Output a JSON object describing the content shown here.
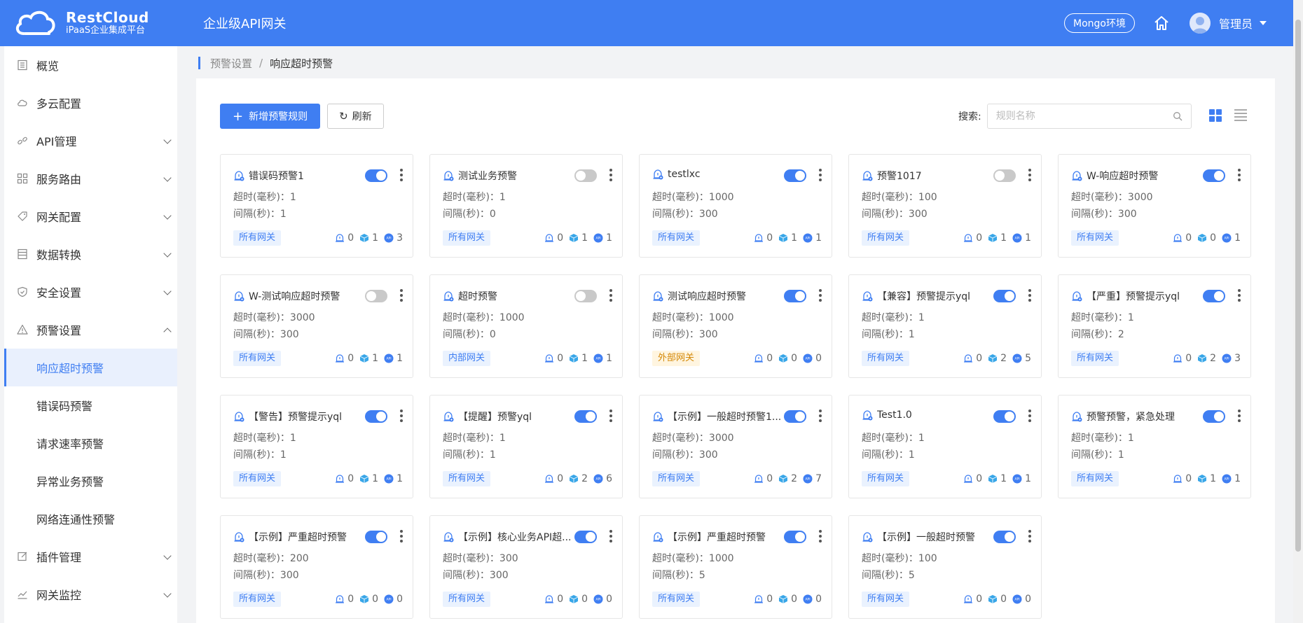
{
  "header": {
    "brand_name": "RestCloud",
    "brand_sub": "iPaaS企业集成平台",
    "title": "企业级API网关",
    "env": "Mongo环境",
    "user": "管理员"
  },
  "sidebar": {
    "items": [
      {
        "label": "概览",
        "icon": "list-icon"
      },
      {
        "label": "多云配置",
        "icon": "cloud-icon"
      },
      {
        "label": "API管理",
        "icon": "link-icon"
      },
      {
        "label": "服务路由",
        "icon": "grid-icon"
      },
      {
        "label": "网关配置",
        "icon": "tag-icon"
      },
      {
        "label": "数据转换",
        "icon": "table-icon"
      },
      {
        "label": "安全设置",
        "icon": "shield-icon"
      },
      {
        "label": "预警设置",
        "icon": "warning-icon"
      },
      {
        "label": "插件管理",
        "icon": "edit-icon"
      },
      {
        "label": "网关监控",
        "icon": "chart-icon"
      }
    ],
    "sub_items": [
      "响应超时预警",
      "错误码预警",
      "请求速率预警",
      "异常业务预警",
      "网络连通性预警"
    ]
  },
  "breadcrumb": {
    "parent": "预警设置",
    "separator": "/",
    "current": "响应超时预警"
  },
  "toolbar": {
    "add_label": "新增预警规则",
    "refresh_label": "刷新",
    "search_label": "搜索:",
    "search_placeholder": "规则名称"
  },
  "cards": [
    {
      "title": "错误码预警1",
      "enabled": true,
      "timeout": "超时(毫秒)：1",
      "interval": "间隔(秒)：1",
      "scope": "所有网关",
      "stats": [
        "0",
        "1",
        "3"
      ]
    },
    {
      "title": "测试业务预警",
      "enabled": false,
      "timeout": "超时(毫秒)：1",
      "interval": "间隔(秒)：0",
      "scope": "所有网关",
      "stats": [
        "0",
        "1",
        "1"
      ]
    },
    {
      "title": "testlxc",
      "enabled": true,
      "timeout": "超时(毫秒)：1000",
      "interval": "间隔(秒)：300",
      "scope": "所有网关",
      "stats": [
        "0",
        "1",
        "1"
      ]
    },
    {
      "title": "预警1017",
      "enabled": false,
      "timeout": "超时(毫秒)：100",
      "interval": "间隔(秒)：300",
      "scope": "所有网关",
      "stats": [
        "0",
        "1",
        "1"
      ]
    },
    {
      "title": "W-响应超时预警",
      "enabled": true,
      "timeout": "超时(毫秒)：3000",
      "interval": "间隔(秒)：300",
      "scope": "所有网关",
      "stats": [
        "0",
        "0",
        "1"
      ]
    },
    {
      "title": "W-测试响应超时预警",
      "enabled": false,
      "timeout": "超时(毫秒)：3000",
      "interval": "间隔(秒)：300",
      "scope": "所有网关",
      "stats": [
        "0",
        "1",
        "1"
      ]
    },
    {
      "title": "超时预警",
      "enabled": false,
      "timeout": "超时(毫秒)：1000",
      "interval": "间隔(秒)：0",
      "scope": "内部网关",
      "stats": [
        "0",
        "1",
        "1"
      ]
    },
    {
      "title": "测试响应超时预警",
      "enabled": true,
      "timeout": "超时(毫秒)：1000",
      "interval": "间隔(秒)：300",
      "scope": "外部网关",
      "stats": [
        "0",
        "0",
        "0"
      ]
    },
    {
      "title": "【兼容】预警提示yql",
      "enabled": true,
      "timeout": "超时(毫秒)：1",
      "interval": "间隔(秒)：1",
      "scope": "所有网关",
      "stats": [
        "0",
        "2",
        "5"
      ]
    },
    {
      "title": "【严重】预警提示yql",
      "enabled": true,
      "timeout": "超时(毫秒)：1",
      "interval": "间隔(秒)：2",
      "scope": "所有网关",
      "stats": [
        "0",
        "2",
        "3"
      ]
    },
    {
      "title": "【警告】预警提示yql",
      "enabled": true,
      "timeout": "超时(毫秒)：1",
      "interval": "间隔(秒)：1",
      "scope": "所有网关",
      "stats": [
        "0",
        "1",
        "1"
      ]
    },
    {
      "title": "【提醒】预警yql",
      "enabled": true,
      "timeout": "超时(毫秒)：1",
      "interval": "间隔(秒)：1",
      "scope": "所有网关",
      "stats": [
        "0",
        "2",
        "6"
      ]
    },
    {
      "title": "【示例】一般超时预警1...",
      "enabled": true,
      "timeout": "超时(毫秒)：3000",
      "interval": "间隔(秒)：300",
      "scope": "所有网关",
      "stats": [
        "0",
        "2",
        "7"
      ]
    },
    {
      "title": "Test1.0",
      "enabled": true,
      "timeout": "超时(毫秒)：1",
      "interval": "间隔(秒)：1",
      "scope": "所有网关",
      "stats": [
        "0",
        "1",
        "1"
      ]
    },
    {
      "title": "预警预警，紧急处理",
      "enabled": true,
      "timeout": "超时(毫秒)：1",
      "interval": "间隔(秒)：1",
      "scope": "所有网关",
      "stats": [
        "0",
        "1",
        "1"
      ]
    },
    {
      "title": "【示例】严重超时预警",
      "enabled": true,
      "timeout": "超时(毫秒)：200",
      "interval": "间隔(秒)：300",
      "scope": "所有网关",
      "stats": [
        "0",
        "0",
        "0"
      ]
    },
    {
      "title": "【示例】核心业务API超...",
      "enabled": true,
      "timeout": "超时(毫秒)：300",
      "interval": "间隔(秒)：300",
      "scope": "所有网关",
      "stats": [
        "0",
        "0",
        "0"
      ]
    },
    {
      "title": "【示例】严重超时预警",
      "enabled": true,
      "timeout": "超时(毫秒)：1000",
      "interval": "间隔(秒)：5",
      "scope": "所有网关",
      "stats": [
        "0",
        "0",
        "0"
      ]
    },
    {
      "title": "【示例】一般超时预警",
      "enabled": true,
      "timeout": "超时(毫秒)：100",
      "interval": "间隔(秒)：5",
      "scope": "所有网关",
      "stats": [
        "0",
        "0",
        "0"
      ]
    }
  ],
  "colors": {
    "primary": "#3f7ef2",
    "warning_tag": "#d48806",
    "toggle_off": "#c9c9c9"
  }
}
